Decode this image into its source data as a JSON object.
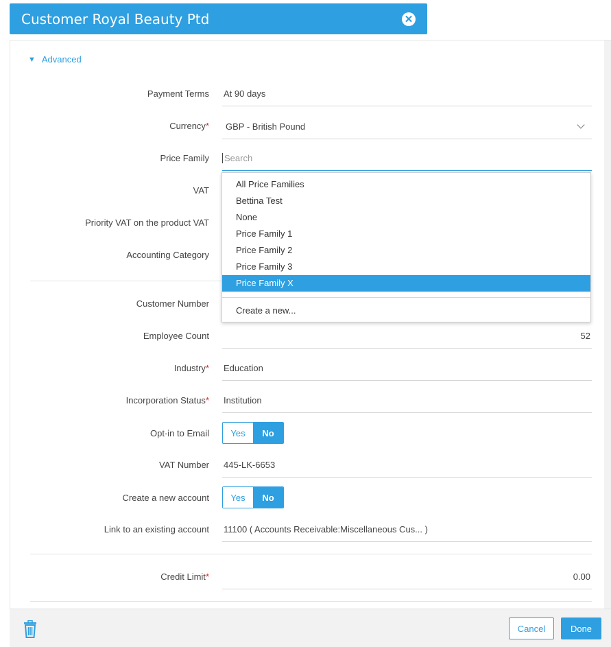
{
  "window": {
    "title": "Customer Royal Beauty Ptd",
    "close_icon": "close-circle-icon"
  },
  "section": {
    "toggle_label": "Advanced",
    "toggle_icon": "caret-down-icon"
  },
  "fields": {
    "payment_terms": {
      "label": "Payment Terms",
      "value": "At 90 days"
    },
    "currency": {
      "label": "Currency",
      "required": "*",
      "value": "GBP - British Pound"
    },
    "price_family": {
      "label": "Price Family",
      "placeholder": "Search"
    },
    "vat": {
      "label": "VAT"
    },
    "priority_vat": {
      "label": "Priority VAT on the product VAT"
    },
    "accounting_category": {
      "label": "Accounting Category"
    },
    "customer_number": {
      "label": "Customer Number"
    },
    "employee_count": {
      "label": "Employee Count",
      "value": "52"
    },
    "industry": {
      "label": "Industry",
      "required": "*",
      "value": "Education"
    },
    "incorporation_status": {
      "label": "Incorporation Status",
      "required": "*",
      "value": "Institution"
    },
    "optin_email": {
      "label": "Opt-in to Email",
      "yes": "Yes",
      "no": "No"
    },
    "vat_number": {
      "label": "VAT Number",
      "value": "445-LK-6653"
    },
    "create_account": {
      "label": "Create a new account",
      "yes": "Yes",
      "no": "No"
    },
    "link_account": {
      "label": "Link to an existing account",
      "value": "11100  ( Accounts Receivable:Miscellaneous Cus... )"
    },
    "credit_limit": {
      "label": "Credit Limit",
      "required": "*",
      "value": "0.00"
    }
  },
  "dropdown": {
    "options": [
      "All Price Families",
      "Bettina Test",
      "None",
      "Price Family 1",
      "Price Family 2",
      "Price Family 3",
      "Price Family X"
    ],
    "selected": "Price Family X",
    "create_new": "Create a new..."
  },
  "footer": {
    "cancel": "Cancel",
    "done": "Done",
    "trash_icon": "trash-icon"
  },
  "colors": {
    "accent": "#2e9fe0",
    "required": "#d9262c"
  }
}
